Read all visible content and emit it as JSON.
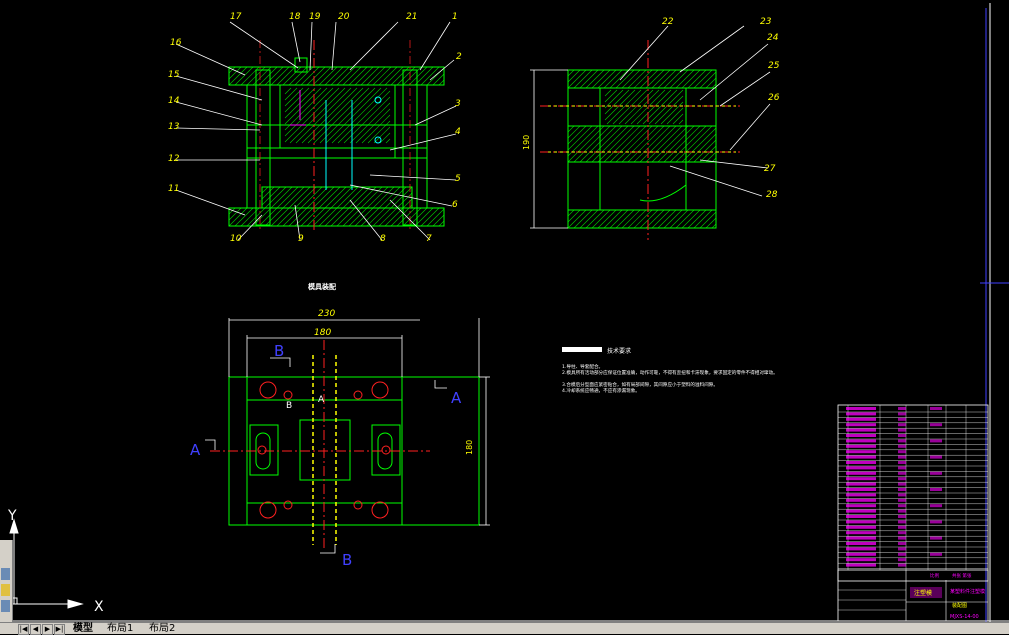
{
  "colors": {
    "background": "#000000",
    "part": "#00ff00",
    "leader": "#ffffff",
    "label": "#ffff00",
    "center": "#ff2020",
    "dimension": "#ffffff",
    "magenta": "#ff00ff",
    "cyan": "#00ffff",
    "blue": "#4040ff"
  },
  "part_labels_left": [
    "17",
    "18",
    "19",
    "20",
    "21",
    "1",
    "2",
    "3",
    "4",
    "5",
    "6",
    "7",
    "8",
    "9",
    "10",
    "11",
    "12",
    "13",
    "14",
    "15",
    "16"
  ],
  "part_labels_right": [
    "22",
    "23",
    "24",
    "25",
    "26",
    "27",
    "28"
  ],
  "dims": {
    "right_height": "190",
    "plan_width_outer": "230",
    "plan_width_inner": "180",
    "plan_height": "180"
  },
  "view_title": "模具装配",
  "section_marks": {
    "b_top": "B",
    "b_bottom": "B",
    "a_left": "A",
    "a_right": "A",
    "small_a": "A",
    "small_b": "B"
  },
  "tech_req": {
    "title": "技术要求",
    "lines": [
      "1.导柱、导套配合。",
      "2.模具所有活动部分应保证位置准确，动作可靠，不得有歪扭和卡滞现象，要求固定的零件不得相对窜动。",
      "3.合模后分型面应紧密贴合，如有局部间隙，其间隙应小于塑料的溢料间隙。",
      "4.冷却系统应畅通，不应有渗漏现象。"
    ]
  },
  "title_block": {
    "main_title": "注塑模",
    "subtitle": "某塑料件注塑模",
    "drawing_no": "MJXS-14-00",
    "scale_label": "比例",
    "sheet_label": "共张 第张",
    "school": "装配图"
  },
  "ucs": {
    "y_label": "Y",
    "x_label": "X"
  },
  "tabs": [
    "模型",
    "布局1",
    "布局2"
  ]
}
